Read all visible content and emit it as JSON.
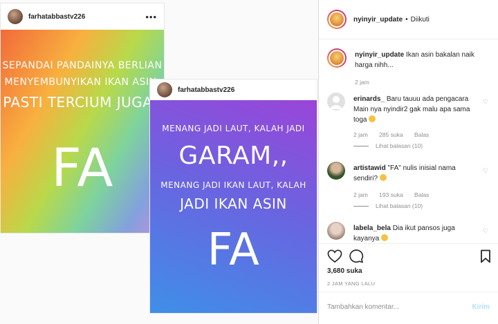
{
  "post1": {
    "username": "farhatabbastv226",
    "more": "•••",
    "lines": [
      "Sepandai pandainya berlian",
      "menyembunyikan ikan asin,",
      "pasti tercium juga..",
      "FA"
    ]
  },
  "post2": {
    "username": "farhatabbastv226",
    "more": "•••",
    "lines": [
      "Menang jadi laut, kalah jadi",
      "GARAM,,",
      "Menang jadi ikan laut, kalah",
      "jadi ikan asin",
      "FA"
    ]
  },
  "detail": {
    "username": "nyinyir_update",
    "separator": "•",
    "follow_status": "Diikuti",
    "caption": {
      "user": "nyinyir_update",
      "text": "Ikan asin bakalan naik harga nihh...",
      "time": "2 jam"
    },
    "comments": [
      {
        "user": "erinards_",
        "text": "Baru tauuu ada pengacara Main nya nyindir2 gak malu apa sama toga",
        "time": "2 jam",
        "likes": "285 suka",
        "reply": "Balas",
        "view_replies": "Lihat balasan (10)",
        "avatar_color": "#e1e1e1"
      },
      {
        "user": "artistawid",
        "text": "\"FA\" nulis inisial nama sendiri?",
        "time": "2 jam",
        "likes": "193 suka",
        "reply": "Balas",
        "view_replies": "Lihat balasan (10)",
        "avatar_color": "#4b6a3a"
      },
      {
        "user": "labela_bela",
        "text": "Dia ikut pansos juga kayanya",
        "avatar_color": "#c9b4a8"
      }
    ],
    "likes": "3,680 suka",
    "time_ago": "2 JAM YANG LALU",
    "add_comment_placeholder": "Tambahkan komentar...",
    "post_button": "Kirim"
  }
}
